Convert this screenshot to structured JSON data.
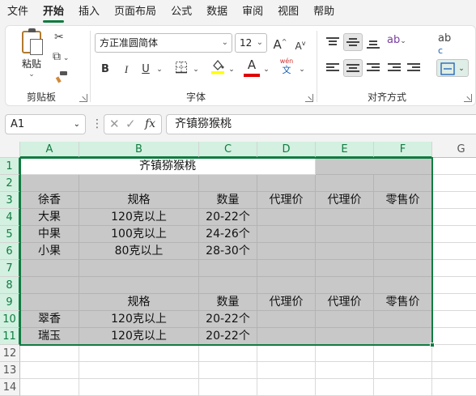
{
  "menu": [
    "文件",
    "开始",
    "插入",
    "页面布局",
    "公式",
    "数据",
    "审阅",
    "视图",
    "帮助"
  ],
  "ribbon": {
    "clipboard": {
      "paste_label": "粘贴",
      "group_label": "剪贴板"
    },
    "font": {
      "font_name": "方正准圆简体",
      "font_size": "12",
      "bold": "B",
      "italic": "I",
      "underline": "U",
      "font_color_letter": "A",
      "phonetic_top": "wén",
      "phonetic_bottom": "文",
      "grow": "A",
      "shrink": "A",
      "group_label": "字体"
    },
    "alignment": {
      "wrap_icon": "ab",
      "wrap_sub": "c",
      "group_label": "对齐方式"
    }
  },
  "formula_bar": {
    "name_box": "A1",
    "fx_label": "fx",
    "content": "齐镇猕猴桃"
  },
  "colors": {
    "accent": "#107c41",
    "fill_gray": "#c8c8c8",
    "highlight_yellow": "#ffff00",
    "font_red": "#e00000"
  },
  "columns": [
    "A",
    "B",
    "C",
    "D",
    "E",
    "F",
    "G"
  ],
  "rows": [
    "1",
    "2",
    "3",
    "4",
    "5",
    "6",
    "7",
    "8",
    "9",
    "10",
    "11",
    "12",
    "13",
    "14"
  ],
  "sheet": {
    "title": "齐镇猕猴桃",
    "header1": [
      "徐香",
      "规格",
      "数量",
      "代理价",
      "代理价",
      "零售价"
    ],
    "block1": [
      [
        "大果",
        "120克以上",
        "20-22个"
      ],
      [
        "中果",
        "100克以上",
        "24-26个"
      ],
      [
        "小果",
        "80克以上",
        "28-30个"
      ]
    ],
    "header2": [
      "",
      "规格",
      "数量",
      "代理价",
      "代理价",
      "零售价"
    ],
    "block2": [
      [
        "翠香",
        "120克以上",
        "20-22个"
      ],
      [
        "瑞玉",
        "120克以上",
        "20-22个"
      ]
    ]
  }
}
